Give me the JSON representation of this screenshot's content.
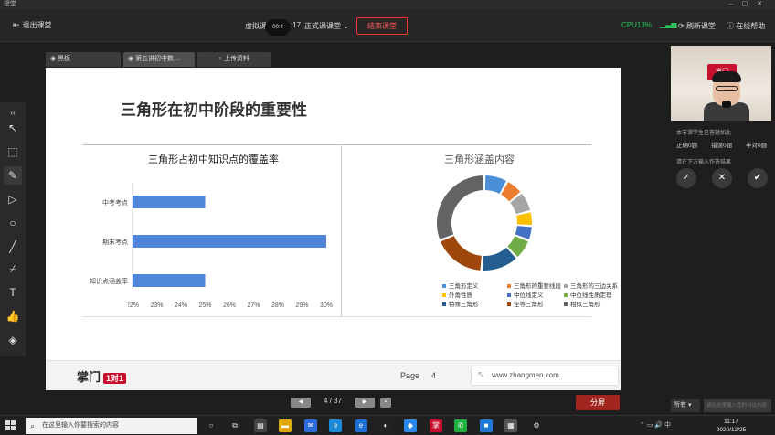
{
  "os_window": {
    "title": "授堂"
  },
  "toolbar": {
    "exit_label": "退出课堂",
    "class_prefix": "虚拟课",
    "timer": "00:4",
    "time_suffix": ":17",
    "formal_label": "正式课课堂",
    "end_label": "结束课堂",
    "cpu": "CPU13%",
    "refresh_label": "刷新课堂",
    "help_label": "在线帮助"
  },
  "tabs": [
    {
      "label": "黑板"
    },
    {
      "label": "第五讲初中数…"
    },
    {
      "label": "+ 上传资料"
    }
  ],
  "slide": {
    "title": "三角形在初中阶段的重要性",
    "page_label": "Page",
    "page_number": "4",
    "website": "www.zhangmen.com",
    "logo_text": "掌门",
    "logo_badge": "1对1"
  },
  "chart_data": [
    {
      "type": "bar",
      "orientation": "horizontal",
      "title": "三角形占初中知识点的覆盖率",
      "categories": [
        "中考考点",
        "期末考点",
        "知识点涵盖率"
      ],
      "values": [
        25,
        30,
        25
      ],
      "xlim": [
        22,
        30
      ],
      "x_ticks": [
        "22%",
        "23%",
        "24%",
        "25%",
        "26%",
        "27%",
        "28%",
        "29%",
        "30%"
      ],
      "color": "#4f86d9"
    },
    {
      "type": "pie",
      "donut": true,
      "title": "三角形涵盖内容",
      "legend": [
        {
          "name": "三角形定义",
          "color": "#4a8fd8"
        },
        {
          "name": "三角形的重要线段",
          "color": "#ed7d31"
        },
        {
          "name": "三角形的三边关系",
          "color": "#a5a5a5"
        },
        {
          "name": "外角性质",
          "color": "#ffc000"
        },
        {
          "name": "中位线定义",
          "color": "#4472c4"
        },
        {
          "name": "中位线性质定理",
          "color": "#70ad47"
        },
        {
          "name": "特殊三角形",
          "color": "#255e91"
        },
        {
          "name": "全等三角形",
          "color": "#9e480e"
        },
        {
          "name": "相似三角形",
          "color": "#636363"
        }
      ],
      "values": [
        8,
        6,
        7,
        5,
        5,
        7,
        13,
        18,
        31
      ]
    }
  ],
  "pager": {
    "current": "4",
    "separator": "/",
    "total": "37",
    "fullscreen_label": "分屏"
  },
  "right_panel": {
    "video_badge": "掌门",
    "prompt": "本节课学生已答题如此",
    "options": [
      "正确0题",
      "错误0题",
      "半对0题"
    ],
    "choose_prompt": "请在下方输入作答结果",
    "chat_selector": "所有",
    "chat_placeholder": "请在这里输入您的讨论内容"
  },
  "taskbar": {
    "search_placeholder": "在这里输入你要搜索的内容",
    "tray_ime": "中",
    "time": "11:17",
    "date": "2020/12/25"
  }
}
